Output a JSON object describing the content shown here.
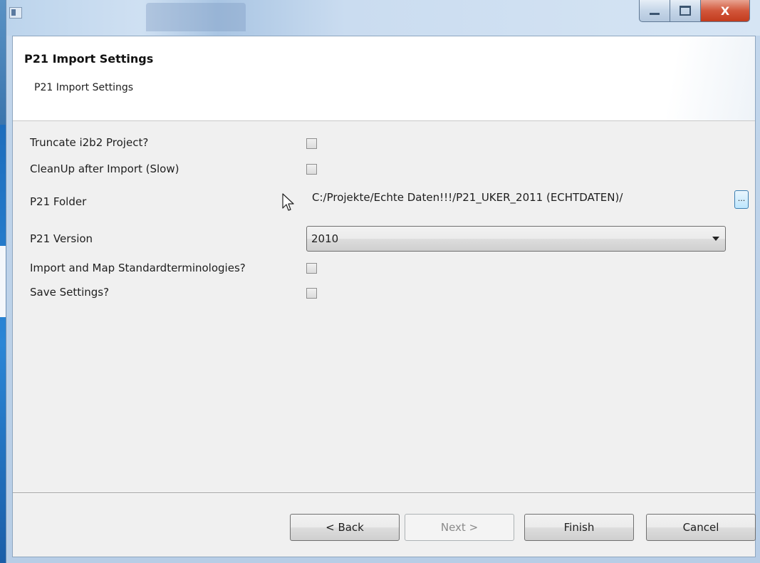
{
  "window": {
    "close_glyph": "X"
  },
  "header": {
    "title": "P21 Import Settings",
    "subtitle": "P21 Import Settings"
  },
  "form": {
    "truncate": {
      "label": "Truncate i2b2 Project?",
      "checked": false
    },
    "cleanup": {
      "label": "CleanUp after Import (Slow)",
      "checked": false
    },
    "folder": {
      "label": "P21 Folder",
      "value": "C:/Projekte/Echte Daten!!!/P21_UKER_2011 (ECHTDATEN)/",
      "browse_label": "..."
    },
    "version": {
      "label": "P21 Version",
      "selected": "2010"
    },
    "standard_terminologies": {
      "label": "Import and Map Standardterminologies?",
      "checked": false
    },
    "save_settings": {
      "label": "Save Settings?",
      "checked": false
    }
  },
  "footer": {
    "back_label": "< Back",
    "next_label": "Next >",
    "finish_label": "Finish",
    "cancel_label": "Cancel",
    "next_enabled": false
  },
  "colors": {
    "titlebar": "#bcd4ec",
    "close_button": "#c94a2d",
    "dialog_bg": "#f0f0f0",
    "browse_button_border": "#3c7fb1"
  }
}
